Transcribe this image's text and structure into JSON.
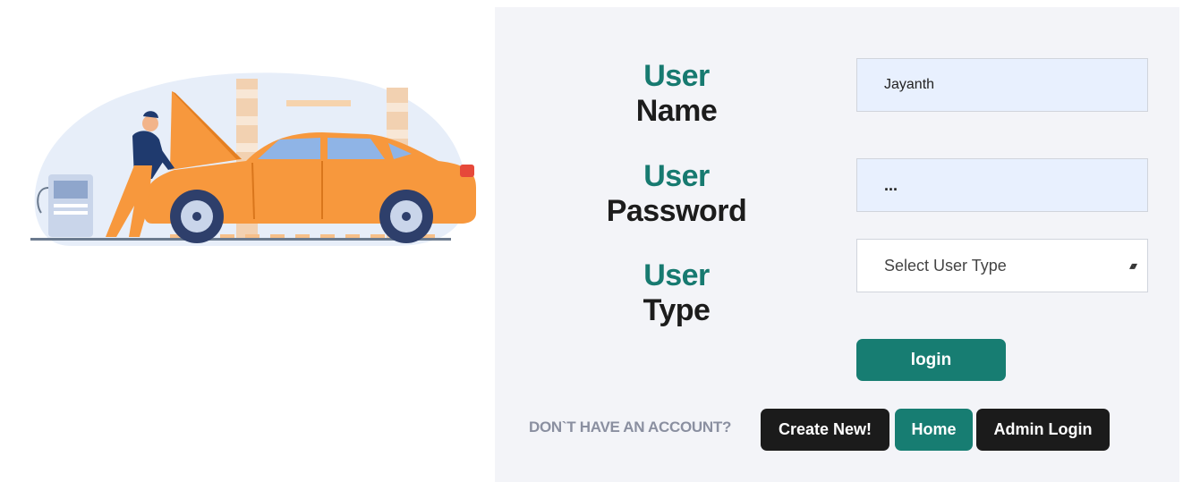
{
  "form": {
    "username": {
      "label_accent": "User",
      "label_rest": "Name",
      "value": "Jayanth"
    },
    "password": {
      "label_accent": "User",
      "label_rest": "Password",
      "value": "..."
    },
    "usertype": {
      "label_accent": "User",
      "label_rest": "Type",
      "selected": "Select User Type"
    },
    "login_label": "login"
  },
  "footer": {
    "prompt": "DON`T HAVE AN ACCOUNT?",
    "create_label": "Create New!",
    "home_label": "Home",
    "admin_label": "Admin Login"
  },
  "colors": {
    "accent": "#177d72",
    "dark_button": "#1b1b1b",
    "car": "#f7983d",
    "panel": "#f3f4f8"
  }
}
